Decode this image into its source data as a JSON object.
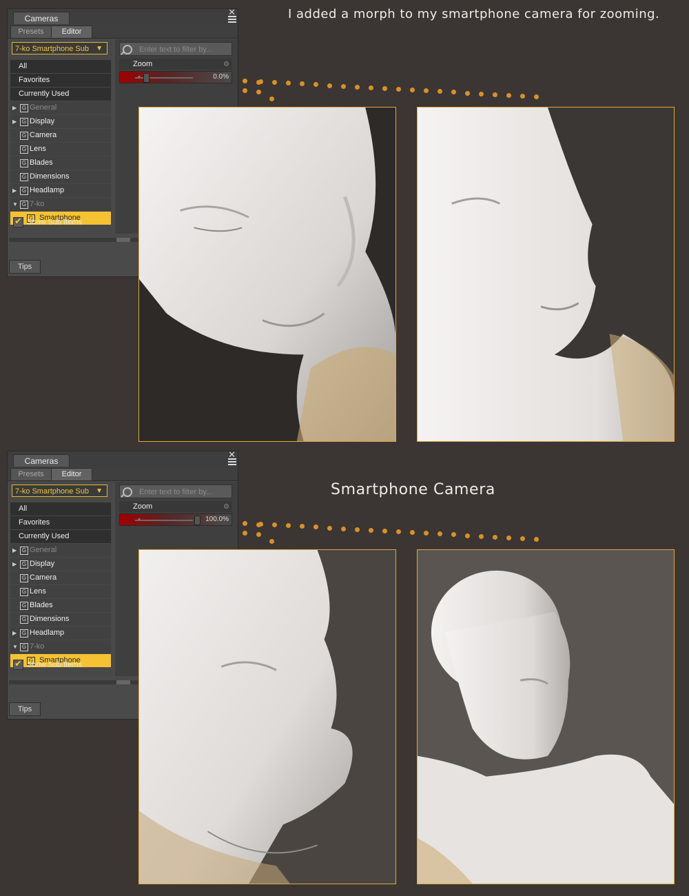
{
  "captions": {
    "top": "I added a morph to my smartphone camera for zooming.",
    "middle": "Smartphone Camera"
  },
  "panels": [
    {
      "title": "Cameras",
      "tabs": [
        "Presets",
        "Editor"
      ],
      "dropdown": "7-ko Smartphone Sub",
      "search_placeholder": "Enter text to filter by...",
      "property": "Zoom",
      "zoom_value": "0.0%",
      "zoom_fraction": 0.0,
      "items": [
        "All",
        "Favorites",
        "Currently Used"
      ],
      "groups": [
        "General",
        "Display",
        "Camera",
        "Lens",
        "Blades",
        "Dimensions",
        "Headlamp",
        "7-ko"
      ],
      "selected": "Smartphone",
      "show_sub": "Show Sub Items",
      "bottom_tab": "Tips"
    },
    {
      "title": "Cameras",
      "tabs": [
        "Presets",
        "Editor"
      ],
      "dropdown": "7-ko Smartphone Sub",
      "search_placeholder": "Enter text to filter by...",
      "property": "Zoom",
      "zoom_value": "100.0%",
      "zoom_fraction": 1.0,
      "items": [
        "All",
        "Favorites",
        "Currently Used"
      ],
      "groups": [
        "General",
        "Display",
        "Camera",
        "Lens",
        "Blades",
        "Dimensions",
        "Headlamp",
        "7-ko"
      ],
      "selected": "Smartphone",
      "show_sub": "Show Sub Items",
      "bottom_tab": "Tips"
    }
  ],
  "colors": {
    "background": "#3b3633",
    "accent": "#f4c232",
    "frame": "#e2a83a",
    "dots": "#d8912a"
  }
}
